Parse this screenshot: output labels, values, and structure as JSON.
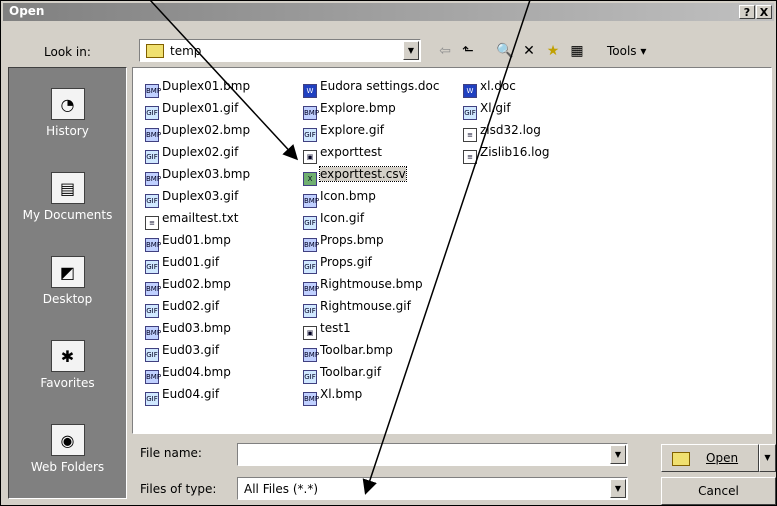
{
  "window": {
    "title": "Open",
    "help_label": "?",
    "close_label": "X"
  },
  "look_in": {
    "label": "Look in:",
    "value": "temp"
  },
  "toolbar": {
    "back": "⇦",
    "up": "⬑",
    "search": "🔍",
    "delete": "✕",
    "newfolder": "★",
    "views": "▦",
    "tools_label": "Tools ▾"
  },
  "places": [
    {
      "label": "History",
      "icon": "◔"
    },
    {
      "label": "My Documents",
      "icon": "▤"
    },
    {
      "label": "Desktop",
      "icon": "◩"
    },
    {
      "label": "Favorites",
      "icon": "✱"
    },
    {
      "label": "Web Folders",
      "icon": "◉"
    }
  ],
  "files": [
    [
      {
        "name": "Duplex01.bmp",
        "type": "bmp",
        "badge": "BMP"
      },
      {
        "name": "Duplex01.gif",
        "type": "gif",
        "badge": "GIF"
      },
      {
        "name": "Duplex02.bmp",
        "type": "bmp",
        "badge": "BMP"
      },
      {
        "name": "Duplex02.gif",
        "type": "gif",
        "badge": "GIF"
      },
      {
        "name": "Duplex03.bmp",
        "type": "bmp",
        "badge": "BMP"
      },
      {
        "name": "Duplex03.gif",
        "type": "gif",
        "badge": "GIF"
      },
      {
        "name": "emailtest.txt",
        "type": "txt",
        "badge": "≡"
      },
      {
        "name": "Eud01.bmp",
        "type": "bmp",
        "badge": "BMP"
      },
      {
        "name": "Eud01.gif",
        "type": "gif",
        "badge": "GIF"
      },
      {
        "name": "Eud02.bmp",
        "type": "bmp",
        "badge": "BMP"
      },
      {
        "name": "Eud02.gif",
        "type": "gif",
        "badge": "GIF"
      },
      {
        "name": "Eud03.bmp",
        "type": "bmp",
        "badge": "BMP"
      },
      {
        "name": "Eud03.gif",
        "type": "gif",
        "badge": "GIF"
      },
      {
        "name": "Eud04.bmp",
        "type": "bmp",
        "badge": "BMP"
      },
      {
        "name": "Eud04.gif",
        "type": "gif",
        "badge": "GIF"
      }
    ],
    [
      {
        "name": "Eudora settings.doc",
        "type": "doc",
        "badge": "W"
      },
      {
        "name": "Explore.bmp",
        "type": "bmp",
        "badge": "BMP"
      },
      {
        "name": "Explore.gif",
        "type": "gif",
        "badge": "GIF"
      },
      {
        "name": "exporttest",
        "type": "blank",
        "badge": "▣"
      },
      {
        "name": "exporttest.csv",
        "type": "csv",
        "badge": "X"
      },
      {
        "name": "Icon.bmp",
        "type": "bmp",
        "badge": "BMP"
      },
      {
        "name": "Icon.gif",
        "type": "gif",
        "badge": "GIF"
      },
      {
        "name": "Props.bmp",
        "type": "bmp",
        "badge": "BMP"
      },
      {
        "name": "Props.gif",
        "type": "gif",
        "badge": "GIF"
      },
      {
        "name": "Rightmouse.bmp",
        "type": "bmp",
        "badge": "BMP"
      },
      {
        "name": "Rightmouse.gif",
        "type": "gif",
        "badge": "GIF"
      },
      {
        "name": "test1",
        "type": "blank",
        "badge": "▣"
      },
      {
        "name": "Toolbar.bmp",
        "type": "bmp",
        "badge": "BMP"
      },
      {
        "name": "Toolbar.gif",
        "type": "gif",
        "badge": "GIF"
      },
      {
        "name": "Xl.bmp",
        "type": "bmp",
        "badge": "BMP"
      }
    ],
    [
      {
        "name": "xl.doc",
        "type": "doc",
        "badge": "W"
      },
      {
        "name": "Xl.gif",
        "type": "gif",
        "badge": "GIF"
      },
      {
        "name": "zisd32.log",
        "type": "log",
        "badge": "≡"
      },
      {
        "name": "Zislib16.log",
        "type": "log",
        "badge": "≡"
      }
    ]
  ],
  "selected_file": "exporttest.csv",
  "file_name": {
    "label": "File name:",
    "value": ""
  },
  "file_type": {
    "label": "Files of type:",
    "value": "All Files (*.*)"
  },
  "buttons": {
    "open": "Open",
    "cancel": "Cancel"
  }
}
